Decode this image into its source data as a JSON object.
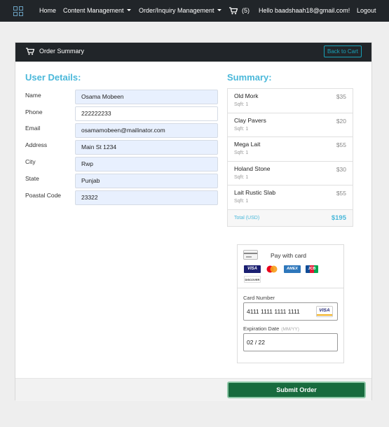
{
  "navbar": {
    "brand_icon": "grid-icon",
    "items": {
      "home": "Home",
      "content": "Content Management",
      "orders": "Order/Inquiry Management"
    },
    "cart_icon": "cart-icon",
    "cart_count": "(5)",
    "greeting": "Hello baadshaah18@gmail.com!",
    "logout": "Logout"
  },
  "card": {
    "title": "Order Summary",
    "title_icon": "cart-icon",
    "back_button": "Back to Cart"
  },
  "user": {
    "heading": "User Details:",
    "fields": [
      {
        "label": "Name",
        "value": "Osama Mobeen"
      },
      {
        "label": "Phone",
        "value": "222222233"
      },
      {
        "label": "Email",
        "value": "osamamobeen@mailinator.com"
      },
      {
        "label": "Address",
        "value": "Main St 1234"
      },
      {
        "label": "City",
        "value": "Rwp"
      },
      {
        "label": "State",
        "value": "Punjab"
      },
      {
        "label": "Poastal Code",
        "value": "23322"
      }
    ]
  },
  "summary": {
    "heading": "Summary:",
    "items": [
      {
        "name": "Old Mork",
        "qty": "Sqft: 1",
        "price": "$35"
      },
      {
        "name": "Clay Pavers",
        "qty": "Sqft: 1",
        "price": "$20"
      },
      {
        "name": "Mega Lait",
        "qty": "Sqft: 1",
        "price": "$55"
      },
      {
        "name": "Holand Stone",
        "qty": "Sqft: 1",
        "price": "$30"
      },
      {
        "name": "Lait Rustic Slab",
        "qty": "Sqft: 1",
        "price": "$55"
      }
    ],
    "total_label": "Total (USD)",
    "total_amount": "$195"
  },
  "payment": {
    "title": "Pay with card",
    "card_icon": "credit-card-icon",
    "logos": {
      "visa": "VISA",
      "amex": "AMEX",
      "jcb": "JCB",
      "discover": "DISCOVER"
    },
    "card_number_label": "Card Number",
    "card_number": "4111 1111 1111 1111",
    "expiry_label": "Expiration Date",
    "expiry_hint": "(MM/YY)",
    "expiry": "02 / 22"
  },
  "footer": {
    "submit": "Submit Order"
  },
  "colors": {
    "navbar": "#212529",
    "accent": "#4ab8da",
    "submit": "#186b3e",
    "input_fill": "#e8f0fe"
  }
}
